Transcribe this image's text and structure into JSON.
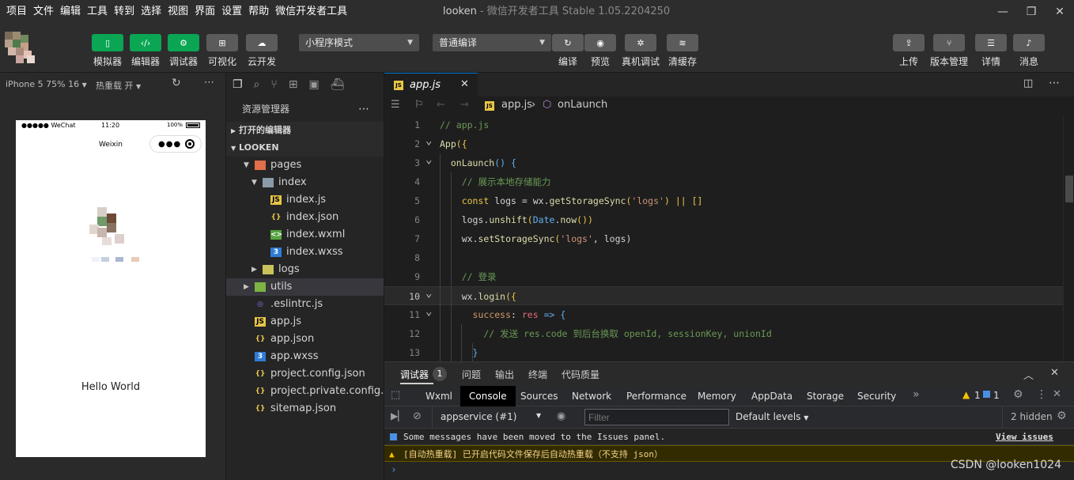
{
  "menu": [
    "项目",
    "文件",
    "编辑",
    "工具",
    "转到",
    "选择",
    "视图",
    "界面",
    "设置",
    "帮助",
    "微信开发者工具"
  ],
  "window": {
    "title_name": "looken",
    "title_rest": " - 微信开发者工具 Stable 1.05.2204250",
    "min": "—",
    "max": "❐",
    "close": "✕"
  },
  "toolbar": {
    "left_buttons": [
      {
        "label": "模拟器",
        "icon": "▯"
      },
      {
        "label": "编辑器",
        "icon": "‹/›"
      },
      {
        "label": "调试器",
        "icon": "⚙"
      },
      {
        "label": "可视化",
        "icon": "⊞"
      },
      {
        "label": "云开发",
        "icon": "☁"
      }
    ],
    "mode_select": "小程序模式",
    "compile_select": "普通编译",
    "mid_buttons": [
      {
        "label": "编译",
        "icon": "↻"
      },
      {
        "label": "预览",
        "icon": "◉"
      },
      {
        "label": "真机调试",
        "icon": "✲"
      },
      {
        "label": "清缓存",
        "icon": "≋"
      }
    ],
    "right_buttons": [
      {
        "label": "上传",
        "icon": "⇪"
      },
      {
        "label": "版本管理",
        "icon": "⑂"
      },
      {
        "label": "详情",
        "icon": "☰"
      },
      {
        "label": "消息",
        "icon": "♪"
      }
    ]
  },
  "simulator": {
    "device": "iPhone 5 75% 16",
    "hot_reload": "热重载 开",
    "status_carrier": "●●●●● WeChat",
    "status_time": "11:20",
    "status_battery": "100%",
    "nav_title": "Weixin",
    "hello": "Hello World"
  },
  "explorer": {
    "title": "资源管理器",
    "open_editors": "打开的编辑器",
    "project": "LOOKEN",
    "items": [
      {
        "name": "pages",
        "kind": "folder-open",
        "arrow": "▼",
        "depth": 1
      },
      {
        "name": "index",
        "kind": "folder-plain",
        "arrow": "▼",
        "depth": 2
      },
      {
        "name": "index.js",
        "kind": "js",
        "depth": 3
      },
      {
        "name": "index.json",
        "kind": "json",
        "depth": 3
      },
      {
        "name": "index.wxml",
        "kind": "wxml",
        "depth": 3
      },
      {
        "name": "index.wxss",
        "kind": "css",
        "depth": 3
      },
      {
        "name": "logs",
        "kind": "folder",
        "arrow": "▶",
        "depth": 2
      },
      {
        "name": "utils",
        "kind": "folder-utils",
        "arrow": "▶",
        "depth": 1,
        "selected": true
      },
      {
        "name": ".eslintrc.js",
        "kind": "eslint",
        "depth": 1
      },
      {
        "name": "app.js",
        "kind": "js",
        "depth": 1
      },
      {
        "name": "app.json",
        "kind": "json",
        "depth": 1
      },
      {
        "name": "app.wxss",
        "kind": "css",
        "depth": 1
      },
      {
        "name": "project.config.json",
        "kind": "json",
        "depth": 1
      },
      {
        "name": "project.private.config.js...",
        "kind": "json",
        "depth": 1
      },
      {
        "name": "sitemap.json",
        "kind": "json",
        "depth": 1
      }
    ]
  },
  "editor": {
    "tab": "app.js",
    "breadcrumb_file": "app.js",
    "breadcrumb_sep": "›",
    "breadcrumb_symbol": "onLaunch",
    "lines": [
      {
        "n": "1",
        "tokens": [
          {
            "t": "// app.js",
            "c": "cm"
          }
        ]
      },
      {
        "n": "2",
        "fold": true,
        "tokens": [
          {
            "t": "App",
            "c": "fn"
          },
          {
            "t": "({",
            "c": "kw"
          }
        ]
      },
      {
        "n": "3",
        "fold": true,
        "tokens": [
          {
            "t": "  onLaunch",
            "c": "fn"
          },
          {
            "t": "() {",
            "c": "ob"
          }
        ]
      },
      {
        "n": "4",
        "tokens": [
          {
            "t": "    // 展示本地存储能力",
            "c": "cm"
          }
        ]
      },
      {
        "n": "5",
        "tokens": [
          {
            "t": "    const ",
            "c": "kw"
          },
          {
            "t": "logs ",
            "c": "pl"
          },
          {
            "t": "= ",
            "c": "pl"
          },
          {
            "t": "wx",
            "c": "pl"
          },
          {
            "t": ".",
            "c": "pl"
          },
          {
            "t": "getStorageSync",
            "c": "fn"
          },
          {
            "t": "(",
            "c": "kw"
          },
          {
            "t": "'logs'",
            "c": "st"
          },
          {
            "t": ") ",
            "c": "kw"
          },
          {
            "t": "|| ",
            "c": "kw"
          },
          {
            "t": "[]",
            "c": "kw"
          }
        ]
      },
      {
        "n": "6",
        "tokens": [
          {
            "t": "    logs",
            "c": "pl"
          },
          {
            "t": ".",
            "c": "pl"
          },
          {
            "t": "unshift",
            "c": "fn"
          },
          {
            "t": "(",
            "c": "kw"
          },
          {
            "t": "Date",
            "c": "ob"
          },
          {
            "t": ".",
            "c": "pl"
          },
          {
            "t": "now",
            "c": "fn"
          },
          {
            "t": "())",
            "c": "kw"
          }
        ]
      },
      {
        "n": "7",
        "tokens": [
          {
            "t": "    wx",
            "c": "pl"
          },
          {
            "t": ".",
            "c": "pl"
          },
          {
            "t": "setStorageSync",
            "c": "fn"
          },
          {
            "t": "(",
            "c": "kw"
          },
          {
            "t": "'logs'",
            "c": "st"
          },
          {
            "t": ", logs)",
            "c": "pl"
          }
        ]
      },
      {
        "n": "8",
        "tokens": []
      },
      {
        "n": "9",
        "tokens": [
          {
            "t": "    // 登录",
            "c": "cm"
          }
        ]
      },
      {
        "n": "10",
        "fold": true,
        "current": true,
        "tokens": [
          {
            "t": "    wx",
            "c": "pl"
          },
          {
            "t": ".",
            "c": "pl"
          },
          {
            "t": "login",
            "c": "fn"
          },
          {
            "t": "({",
            "c": "kw"
          }
        ]
      },
      {
        "n": "11",
        "fold": true,
        "tokens": [
          {
            "t": "      success",
            "c": "pr"
          },
          {
            "t": ": ",
            "c": "pl"
          },
          {
            "t": "res ",
            "c": "vr"
          },
          {
            "t": "=> {",
            "c": "ob"
          }
        ]
      },
      {
        "n": "12",
        "tokens": [
          {
            "t": "        // 发送 res.code 到后台换取 openId, sessionKey, unionId",
            "c": "cm"
          }
        ]
      },
      {
        "n": "13",
        "tokens": [
          {
            "t": "      }",
            "c": "ob"
          }
        ]
      }
    ]
  },
  "debugger": {
    "title": "调试器",
    "badge": "1",
    "tabs_top": [
      "问题",
      "输出",
      "终端",
      "代码质量"
    ],
    "devtools_tabs": [
      "Wxml",
      "Console",
      "Sources",
      "Network",
      "Performance",
      "Memory",
      "AppData",
      "Storage",
      "Security"
    ],
    "active_tab": "Console",
    "more": "»",
    "warn_count": "1",
    "info_count": "1",
    "context": "appservice (#1)",
    "filter_placeholder": "Filter",
    "levels": "Default levels",
    "hidden": "2 hidden",
    "messages": [
      {
        "kind": "info",
        "text": "Some messages have been moved to the Issues panel.",
        "link": "View issues"
      },
      {
        "kind": "warn",
        "text": "[自动热重载] 已开启代码文件保存后自动热重载（不支持 json）"
      }
    ],
    "prompt": "›"
  },
  "watermark": "CSDN @looken1024",
  "colors": {
    "green": "#0aa654",
    "accent": "#0078d4",
    "warn_bg": "#332b00"
  }
}
